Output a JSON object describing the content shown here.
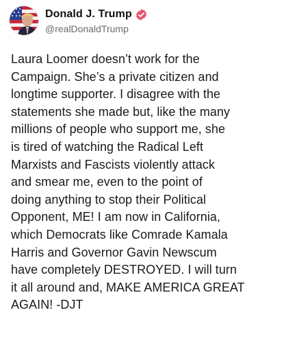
{
  "author": {
    "display_name": "Donald J. Trump",
    "handle": "@realDonaldTrump",
    "verified": true,
    "avatar_icon": "avatar-flag-portrait",
    "verified_icon": "verified-badge-icon",
    "verified_color": "#e8546d"
  },
  "post": {
    "text": "Laura Loomer doesn’t work for the\nCampaign. She’s a private citizen and\nlongtime supporter. I disagree with the\nstatements she made but, like the many\nmillions of people who support me, she\nis tired of watching the Radical Left\nMarxists and Fascists violently attack\nand smear me, even to the point of\ndoing anything to stop their Political\nOpponent, ME! I am now in California,\nwhich Democrats like Comrade Kamala\nHarris and Governor Gavin Newscum\nhave completely DESTROYED. I will turn\nit all around and, MAKE AMERICA GREAT\nAGAIN! -DJT"
  }
}
